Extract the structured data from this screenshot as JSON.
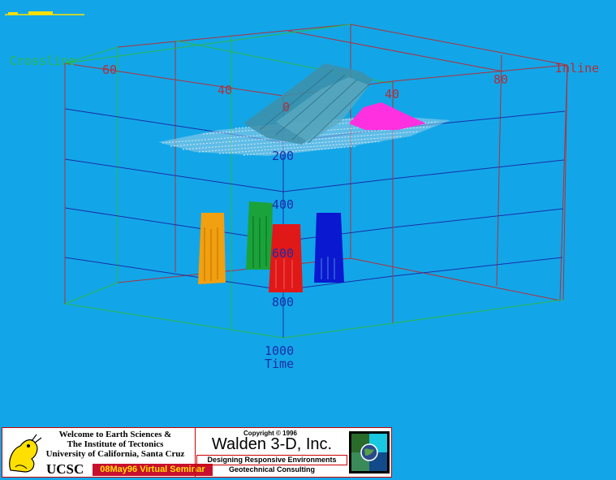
{
  "scene": {
    "axes": {
      "inline_label": "Inline",
      "crossline_label": "Crossline",
      "time_label": "Time",
      "inline_ticks": [
        "40",
        "80"
      ],
      "crossline_ticks": [
        "60",
        "40",
        "0"
      ],
      "time_ticks": [
        "200",
        "400",
        "600",
        "800",
        "1000"
      ]
    },
    "colors": {
      "background": "#12a6e8",
      "box_red": "#b0303a",
      "box_blue": "#1c2ea8",
      "box_green": "#2ab84a",
      "horizon_white": "#e8eef4",
      "fault_teal": "#3f8fa8",
      "body_magenta": "#ff30e0",
      "bodies": [
        "#f0a010",
        "#1aa33a",
        "#e01818",
        "#0a18d0"
      ]
    }
  },
  "banner": {
    "welcome_lines": [
      "Welcome to Earth Sciences &",
      "The Institute of Tectonics",
      "University of California, Santa Cruz"
    ],
    "ucsc": "UCSC",
    "seminar": "08May96 Virtual Seminar",
    "copyright": "Copyright © 1996",
    "company": "Walden 3-D, Inc.",
    "tagline": "Designing Responsive Environments",
    "consulting": "Geotechnical Consulting"
  }
}
